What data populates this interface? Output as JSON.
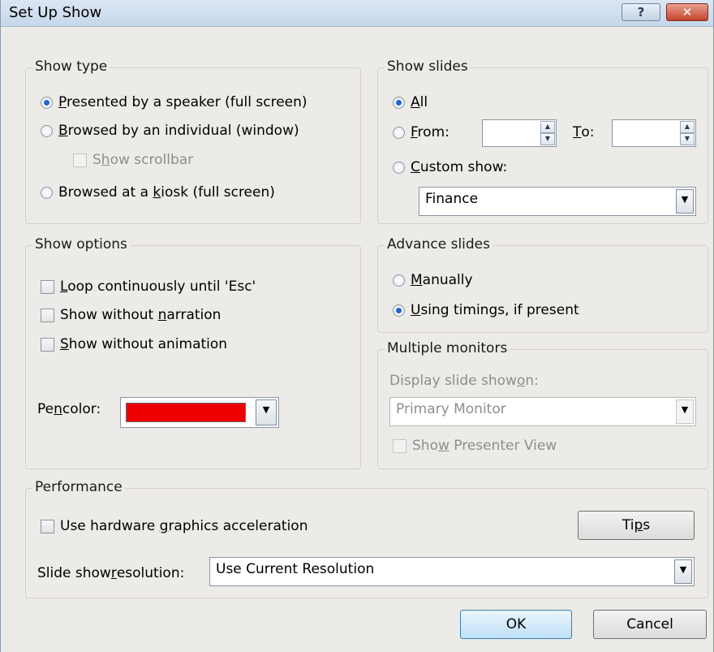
{
  "window": {
    "title": "Set Up Show",
    "help_label": "?",
    "close_label": "✕"
  },
  "show_type": {
    "legend": "Show type",
    "presented": {
      "pre": "",
      "u": "P",
      "post": "resented by a speaker (full screen)",
      "selected": true
    },
    "browsed_individual": {
      "pre": "",
      "u": "B",
      "post": "rowsed by an individual (window)",
      "selected": false
    },
    "show_scrollbar": {
      "pre": "S",
      "u": "h",
      "post": "ow scrollbar",
      "checked": false,
      "enabled": false
    },
    "browsed_kiosk": {
      "pre": "Browsed at a ",
      "u": "k",
      "post": "iosk (full screen)",
      "selected": false
    }
  },
  "show_slides": {
    "legend": "Show slides",
    "all": {
      "pre": "",
      "u": "A",
      "post": "ll",
      "selected": true
    },
    "from": {
      "pre": "",
      "u": "F",
      "post": "rom:",
      "selected": false,
      "value": ""
    },
    "to": {
      "pre": "",
      "u": "T",
      "post": "o:",
      "value": ""
    },
    "custom": {
      "pre": "",
      "u": "C",
      "post": "ustom show:",
      "selected": false
    },
    "custom_value": "Finance"
  },
  "show_options": {
    "legend": "Show options",
    "loop": {
      "pre": "",
      "u": "L",
      "post": "oop continuously until 'Esc'",
      "checked": false
    },
    "no_narration": {
      "pre": "Show without ",
      "u": "n",
      "post": "arration",
      "checked": false
    },
    "no_animation": {
      "pre": "",
      "u": "S",
      "post": "how without animation",
      "checked": false
    },
    "pen_color": {
      "pre": "Pe",
      "u": "n",
      "post": " color:",
      "value": "#ee0000"
    }
  },
  "advance_slides": {
    "legend": "Advance slides",
    "manually": {
      "pre": "",
      "u": "M",
      "post": "anually",
      "selected": false
    },
    "timings": {
      "pre": "",
      "u": "U",
      "post": "sing timings, if present",
      "selected": true
    }
  },
  "multiple_monitors": {
    "legend": "Multiple monitors",
    "display_label": {
      "pre": "Display slide show ",
      "u": "o",
      "post": "n:"
    },
    "monitor_value": "Primary Monitor",
    "presenter_view": {
      "pre": "Sho",
      "u": "w",
      "post": " Presenter View",
      "checked": false,
      "enabled": false
    }
  },
  "performance": {
    "legend": "Performance",
    "hw_accel": {
      "pre": "Use hardware ",
      "u": "g",
      "post": "raphics acceleration",
      "checked": false
    },
    "tips": {
      "pre": "Ti",
      "u": "p",
      "post": "s"
    },
    "resolution_label": {
      "pre": "Slide show ",
      "u": "r",
      "post": "esolution:"
    },
    "resolution_value": "Use Current Resolution"
  },
  "buttons": {
    "ok": "OK",
    "cancel": "Cancel"
  }
}
